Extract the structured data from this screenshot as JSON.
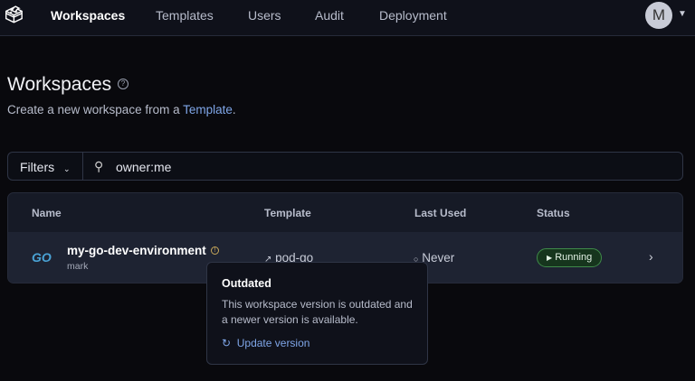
{
  "nav": {
    "items": [
      "Workspaces",
      "Templates",
      "Users",
      "Audit",
      "Deployment"
    ],
    "avatar": "M"
  },
  "page": {
    "title": "Workspaces",
    "subtitle_prefix": "Create a new workspace from a ",
    "subtitle_link": "Template",
    "subtitle_suffix": "."
  },
  "filter": {
    "label": "Filters",
    "query": "owner:me"
  },
  "table": {
    "headers": [
      "Name",
      "Template",
      "Last Used",
      "Status"
    ],
    "rows": [
      {
        "icon": "GO",
        "name": "my-go-dev-environment",
        "owner": "mark",
        "template": "pod-go",
        "last_used": "Never",
        "status": "Running"
      }
    ]
  },
  "popover": {
    "title": "Outdated",
    "description": "This workspace version is outdated and a newer version is available.",
    "action": "Update version"
  }
}
